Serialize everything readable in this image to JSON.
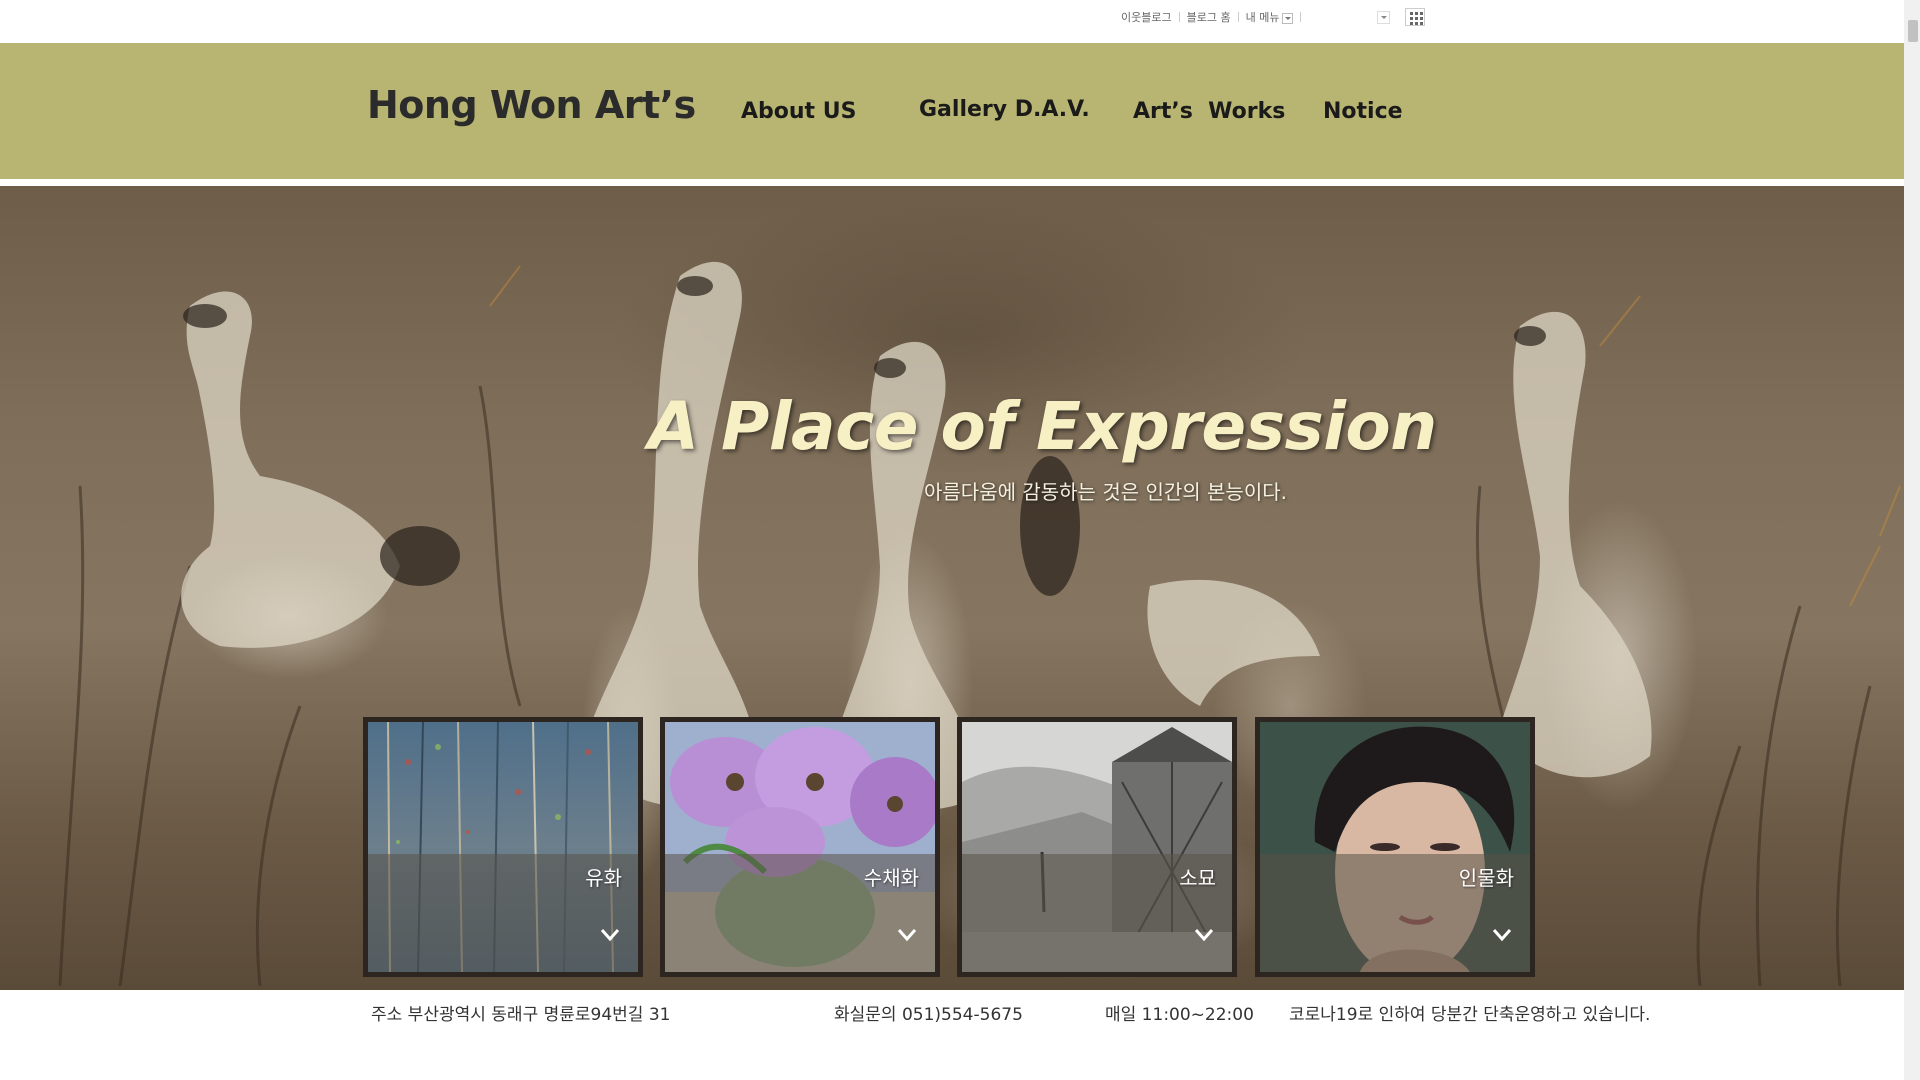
{
  "topbar": {
    "links": [
      "이웃블로그",
      "블로그 홈",
      "내 메뉴"
    ]
  },
  "header": {
    "brand": "Hong Won Art’s",
    "nav": [
      "About US",
      "Gallery D.A.V.",
      "Art’s  Works",
      "Notice"
    ]
  },
  "hero": {
    "title": "A Place of Expression",
    "subtitle": "아름다움에 감동하는 것은 인간의 본능이다."
  },
  "categories": [
    {
      "label": "유화"
    },
    {
      "label": "수채화"
    },
    {
      "label": "소묘"
    },
    {
      "label": "인물화"
    }
  ],
  "footer": {
    "address": "주소  부산광역시 동래구 명륜로94번길 31",
    "phone": "화실문의 051)554-5675",
    "hours": "매일 11:00~22:00",
    "notice": "코로나19로 인하여 당분간 단축운영하고 있습니다."
  },
  "colors": {
    "header_bg": "#b7b571",
    "hero_title": "#f7f0c4"
  }
}
